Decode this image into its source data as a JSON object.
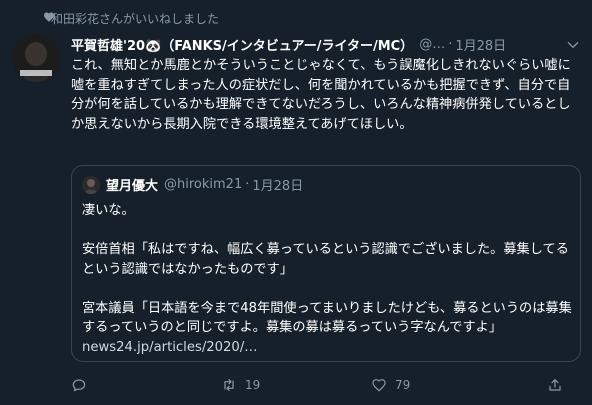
{
  "social_context": "和田彩花さんがいいねしました",
  "tweet": {
    "display_name": "平賀哲雄'20🐼（FANKS/インタビュアー/ライター/MC）",
    "handle": "@…",
    "separator": "·",
    "date": "1月28日",
    "text": "これ、無知とか馬鹿とかそういうことじゃなくて、もう誤魔化しきれないぐらい嘘に嘘を重ねすぎてしまった人の症状だし、何を聞かれているかも把握できず、自分で自分が何を話しているかも理解できてないだろうし、いろんな精神病併発しているとしか思えないから長期入院できる環境整えてあげてほしい。"
  },
  "quote": {
    "display_name": "望月優大",
    "handle": "@hirokim21",
    "separator": "·",
    "date": "1月28日",
    "text": "凄いな。\n\n安倍首相「私はですね、幅広く募っているという認識でございました。募集してるという認識ではなかったものです」\n\n宮本議員「日本語を今まで48年間使ってまいりましたけども、募るというのは募集するっていうのと同じですよ。募集の募は募るっていう字なんですよ」",
    "link": "news24.jp/articles/2020/…"
  },
  "actions": {
    "reply_count": "",
    "retweet_count": "19",
    "like_count": "79"
  },
  "colors": {
    "background": "#15202b",
    "secondary_text": "#8899a6",
    "border": "#38444d"
  }
}
